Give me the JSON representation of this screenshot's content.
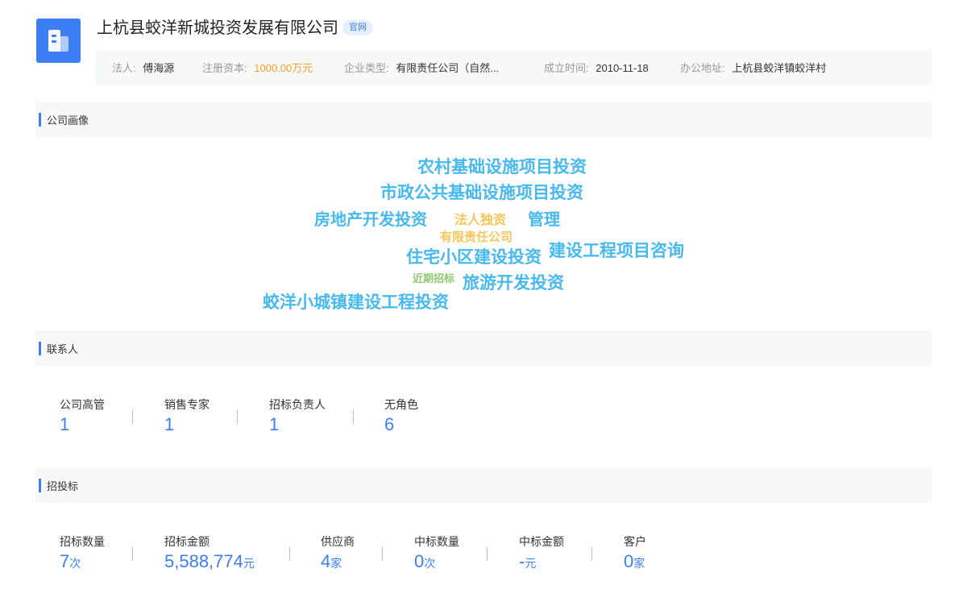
{
  "company": {
    "name": "上杭县蛟洋新城投资发展有限公司",
    "official_site_tag": "官网",
    "logo_icon": "building-icon",
    "accent_color": "#3d7ef5"
  },
  "info": {
    "legal_person_label": "法人:",
    "legal_person": "傅海源",
    "capital_label": "注册资本:",
    "capital": "1000.00万元",
    "type_label": "企业类型:",
    "type": "有限责任公司（自然...",
    "founded_label": "成立时间:",
    "founded": "2010-11-18",
    "address_label": "办公地址:",
    "address": "上杭县蛟洋镇蛟洋村"
  },
  "portrait": {
    "title": "公司画像",
    "words": [
      "农村基础设施项目投资",
      "市政公共基础设施项目投资",
      "房地产开发投资",
      "法人独资",
      "管理",
      "有限责任公司",
      "住宅小区建设投资",
      "建设工程项目咨询",
      "近期招标",
      "旅游开发投资",
      "蛟洋小城镇建设工程投资"
    ]
  },
  "contacts": {
    "title": "联系人",
    "stats": [
      {
        "label": "公司高管",
        "value": "1"
      },
      {
        "label": "销售专家",
        "value": "1"
      },
      {
        "label": "招标负责人",
        "value": "1"
      },
      {
        "label": "无角色",
        "value": "6"
      }
    ]
  },
  "bidding": {
    "title": "招投标",
    "stats": [
      {
        "label": "招标数量",
        "value": "7",
        "unit": "次"
      },
      {
        "label": "招标金额",
        "value": "5,588,774",
        "unit": "元"
      },
      {
        "label": "供应商",
        "value": "4",
        "unit": "家"
      },
      {
        "label": "中标数量",
        "value": "0",
        "unit": "次"
      },
      {
        "label": "中标金额",
        "value": "-",
        "unit": "元"
      },
      {
        "label": "客户",
        "value": "0",
        "unit": "家"
      }
    ]
  }
}
